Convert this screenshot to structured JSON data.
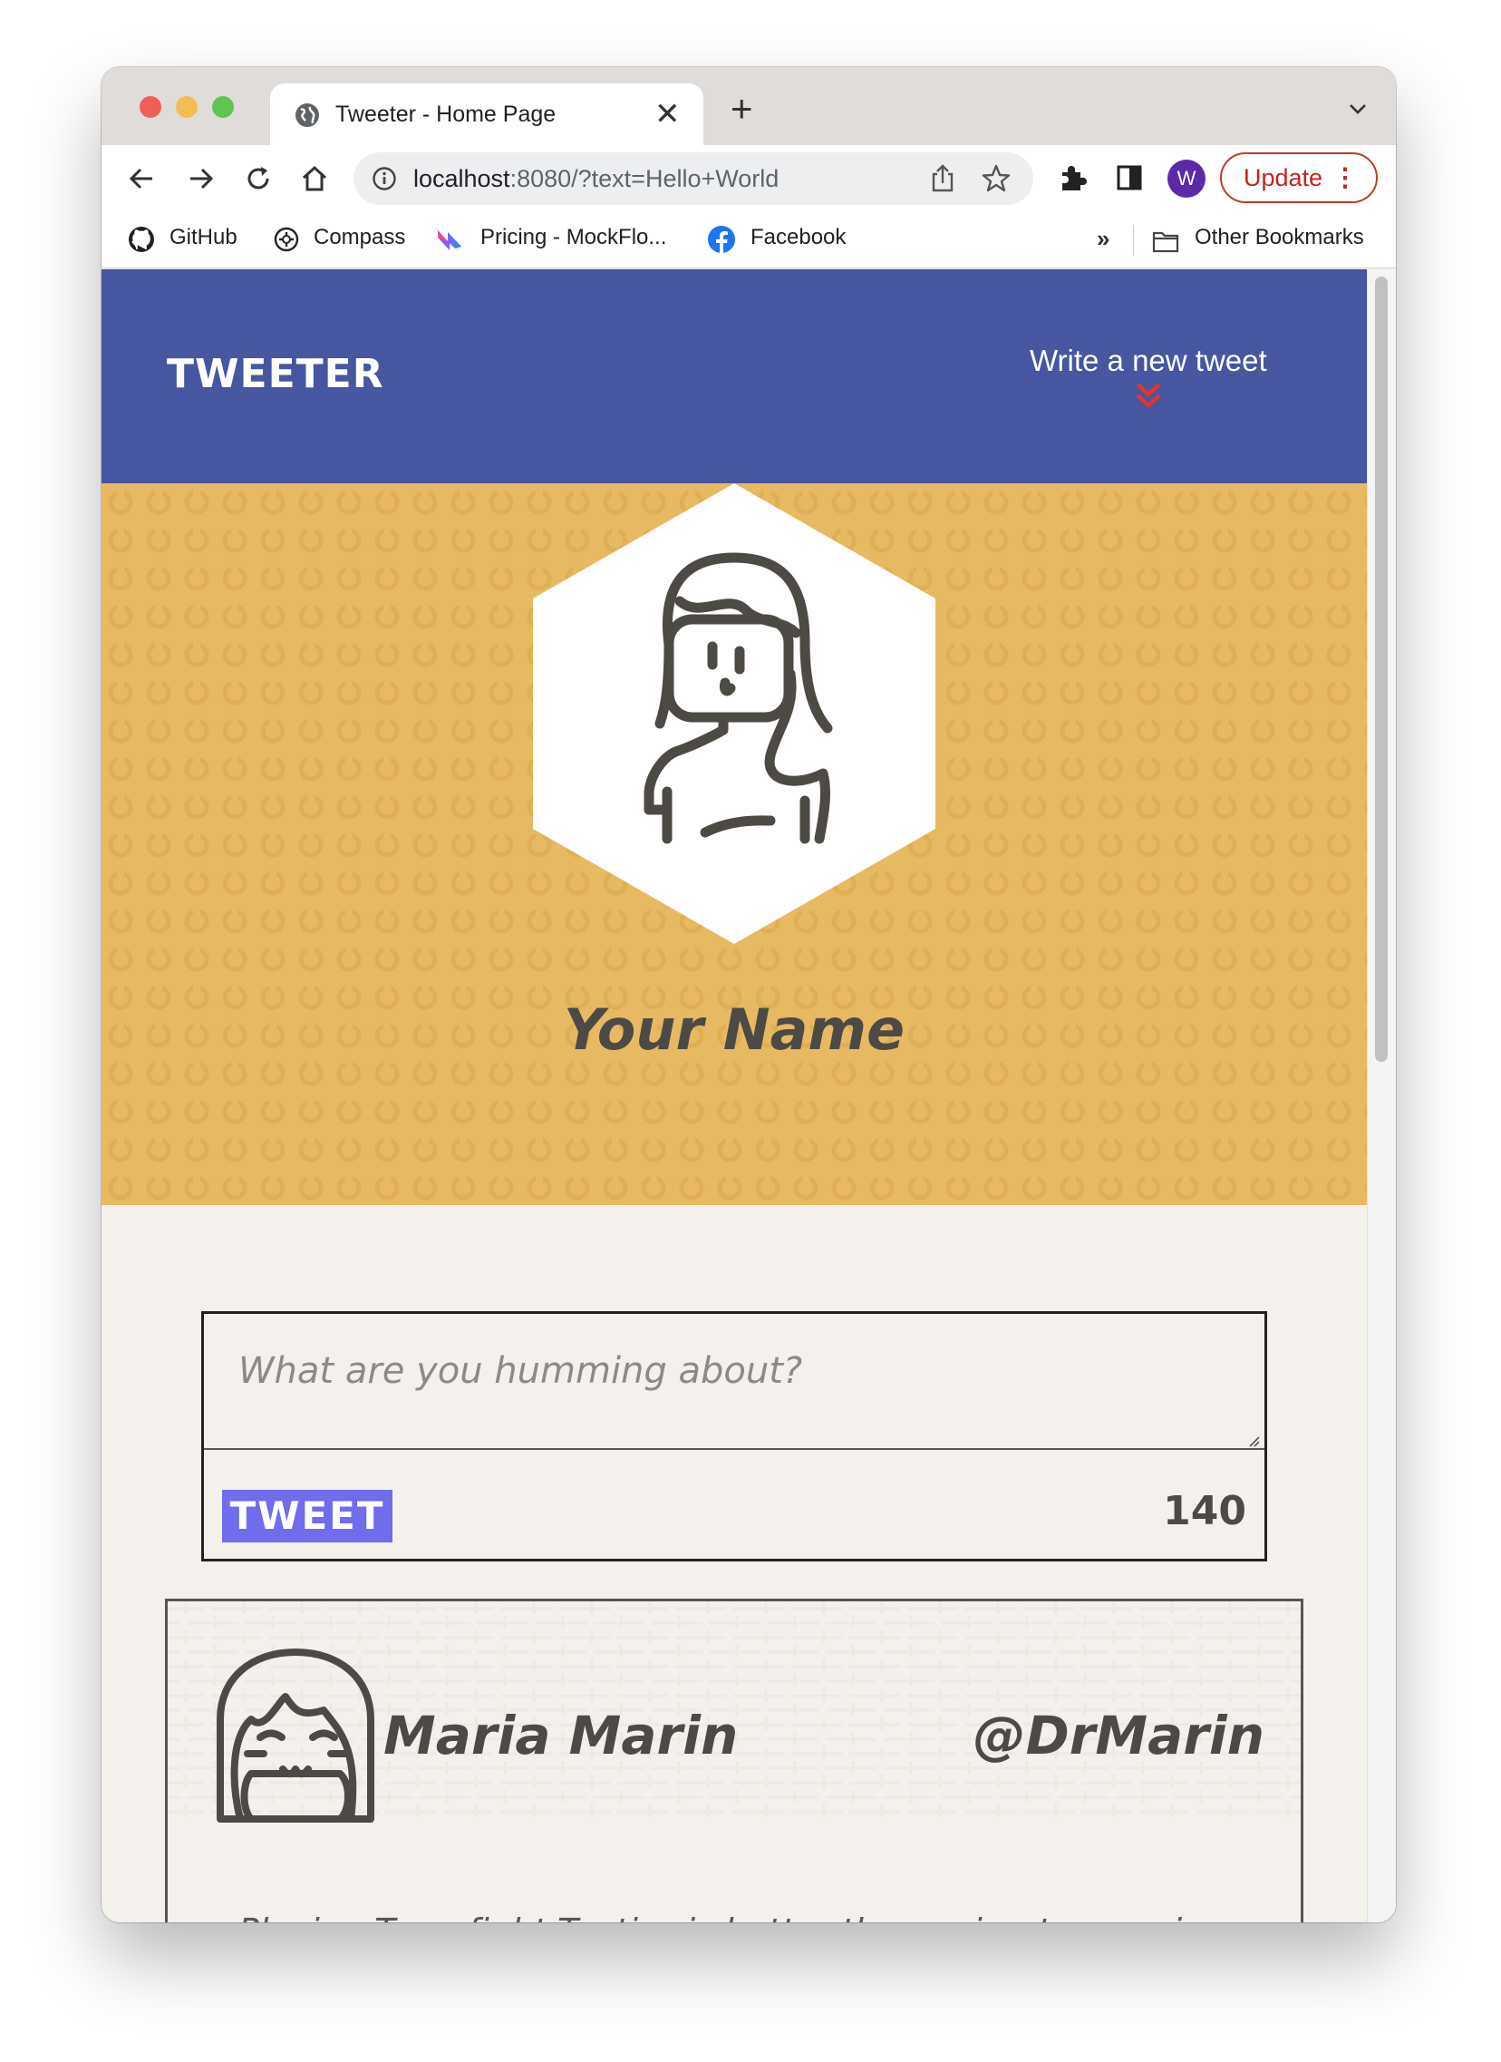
{
  "browser": {
    "tab_title": "Tweeter - Home Page",
    "url_host": "localhost",
    "url_rest": ":8080/?text=Hello+World",
    "profile_initial": "W",
    "update_label": "Update",
    "bookmarks": [
      "GitHub",
      "Compass",
      "Pricing - MockFlo...",
      "Facebook"
    ],
    "bookmarks_more": "»",
    "other_bookmarks": "Other Bookmarks"
  },
  "nav": {
    "brand": "TWEETER",
    "write_link": "Write a new tweet",
    "accent_color": "#e3342f"
  },
  "profile": {
    "name": "Your Name"
  },
  "composer": {
    "placeholder": "What are you humming about?",
    "tweet_label": "TWEET",
    "counter": "140"
  },
  "tweets": [
    {
      "name": "Maria Marin",
      "handle": "@DrMarin",
      "text": "Playing Teamfight Tactics is better than going to a casino"
    }
  ],
  "colors": {
    "nav_bg": "#4656a0",
    "hero_bg": "#e8b963",
    "page_bg": "#f4f1ec",
    "tweet_button": "#6f6ced",
    "text_dark": "#4d4a45"
  }
}
